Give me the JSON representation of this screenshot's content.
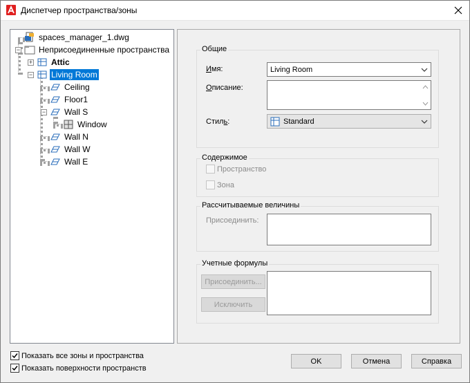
{
  "window": {
    "title": "Диспетчер пространства/зоны"
  },
  "tree": {
    "root": "spaces_manager_1.dwg",
    "group": "Неприсоединенные пространства",
    "items": [
      {
        "label": "Attic",
        "bold": true
      },
      {
        "label": "Living Room",
        "selected": true
      },
      {
        "label": "Ceiling"
      },
      {
        "label": "Floor1"
      },
      {
        "label": "Wall S"
      },
      {
        "label": "Window"
      },
      {
        "label": "Wall N"
      },
      {
        "label": "Wall W"
      },
      {
        "label": "Wall E"
      }
    ]
  },
  "general": {
    "title": "Общие",
    "name_label": "Имя:",
    "name_value": "Living Room",
    "description_label": "Описание:",
    "description_value": "",
    "style_label": "Стиль:",
    "style_value": "Standard"
  },
  "contents": {
    "title": "Содержимое",
    "space_label": "Пространство",
    "zone_label": "Зона"
  },
  "calculated": {
    "title": "Рассчитываемые величины",
    "attach_label": "Присоединить:"
  },
  "formulas": {
    "title": "Учетные формулы",
    "attach_button": "Присоединить...",
    "exclude_button": "Исключить"
  },
  "bottom": {
    "show_all_label": "Показать все зоны и пространства",
    "show_all_checked": true,
    "show_surfaces_label": "Показать поверхности пространств",
    "show_surfaces_checked": true,
    "ok": "OK",
    "cancel": "Отмена",
    "help": "Справка"
  },
  "colors": {
    "selection": "#0078d7",
    "app_icon": "#e02020"
  }
}
